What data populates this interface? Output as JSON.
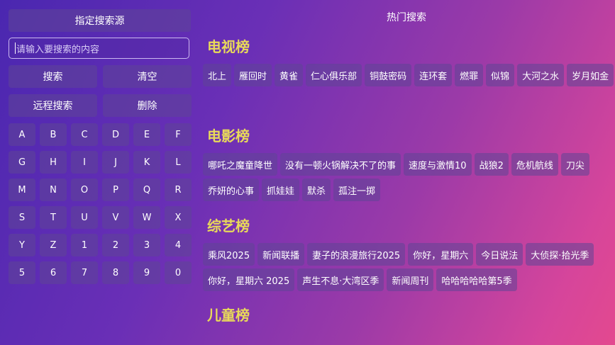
{
  "left": {
    "source_button": "指定搜索源",
    "search_placeholder": "请输入要搜索的内容",
    "search_button": "搜索",
    "clear_button": "清空",
    "remote_search_button": "远程搜索",
    "delete_button": "删除",
    "keys": [
      "A",
      "B",
      "C",
      "D",
      "E",
      "F",
      "G",
      "H",
      "I",
      "J",
      "K",
      "L",
      "M",
      "N",
      "O",
      "P",
      "Q",
      "R",
      "S",
      "T",
      "U",
      "V",
      "W",
      "X",
      "Y",
      "Z",
      "1",
      "2",
      "3",
      "4",
      "5",
      "6",
      "7",
      "8",
      "9",
      "0"
    ]
  },
  "right": {
    "title": "热门搜索",
    "sections": [
      {
        "title": "电视榜",
        "items": [
          "北上",
          "雁回时",
          "黄雀",
          "仁心俱乐部",
          "铜鼓密码",
          "连环套",
          "燃罪",
          "似锦",
          "大河之水",
          "岁月如金"
        ]
      },
      {
        "title": "电影榜",
        "items": [
          "哪吒之魔童降世",
          "没有一顿火锅解决不了的事",
          "速度与激情10",
          "战狼2",
          "危机航线",
          "刀尖",
          "乔妍的心事",
          "抓娃娃",
          "默杀",
          "孤注一掷"
        ]
      },
      {
        "title": "综艺榜",
        "items": [
          "乘风2025",
          "新闻联播",
          "妻子的浪漫旅行2025",
          "你好，星期六",
          "今日说法",
          "大侦探·拾光季",
          "你好，星期六 2025",
          "声生不息·大湾区季",
          "新闻周刊",
          "哈哈哈哈哈第5季"
        ]
      },
      {
        "title": "儿童榜",
        "items": []
      }
    ]
  }
}
